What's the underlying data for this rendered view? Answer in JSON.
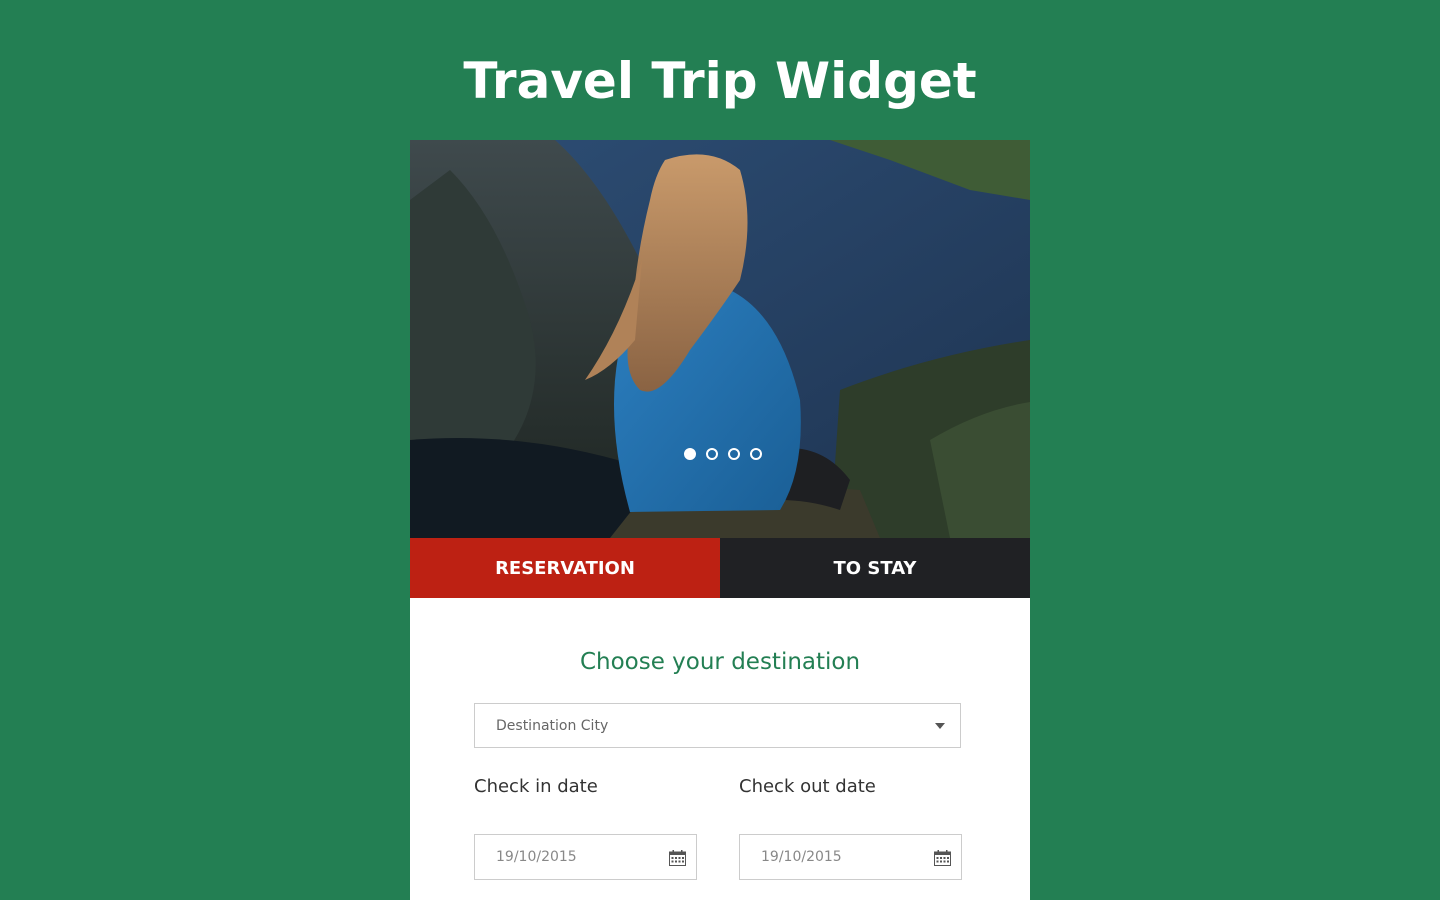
{
  "page": {
    "title": "Travel Trip Widget"
  },
  "carousel": {
    "slides": 4,
    "active_index": 0
  },
  "tabs": [
    {
      "label": "RESERVATION",
      "active": true
    },
    {
      "label": "TO STAY",
      "active": false
    }
  ],
  "form": {
    "heading": "Choose your destination",
    "destination": {
      "value": "Destination City",
      "icon": "chevron-down-icon"
    },
    "check_in": {
      "label": "Check in date",
      "value": "19/10/2015",
      "icon": "calendar-icon"
    },
    "check_out": {
      "label": "Check out date",
      "value": "19/10/2015",
      "icon": "calendar-icon"
    }
  },
  "colors": {
    "background": "#237f53",
    "accent_red": "#bd2113",
    "dark_tab": "#202124",
    "heading_green": "#237f53"
  }
}
